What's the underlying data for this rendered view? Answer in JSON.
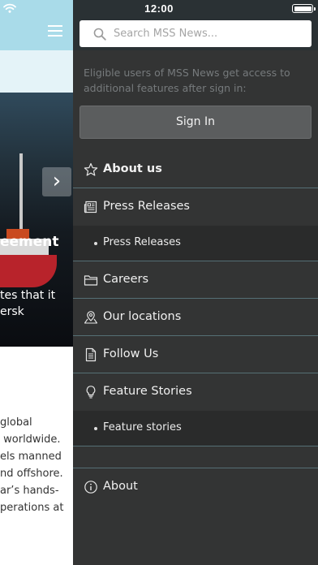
{
  "status_bar": {
    "time": "12:00"
  },
  "background_page": {
    "hero_title": "eement",
    "hero_body": "tes that it\nersk",
    "body_text": "global\n worldwide.\nels manned\nnd offshore.\nar’s hands-\nperations at"
  },
  "drawer": {
    "search": {
      "placeholder": "Search MSS News..."
    },
    "promo_text": "Eligible users of MSS News get access to additional features after sign in:",
    "sign_in_label": "Sign In",
    "items": [
      {
        "label": "About us",
        "icon": "star-icon"
      },
      {
        "label": "Press Releases",
        "icon": "newspaper-icon"
      },
      {
        "label": "Press Releases",
        "icon": "bullet"
      },
      {
        "label": "Careers",
        "icon": "folder-icon"
      },
      {
        "label": "Our locations",
        "icon": "map-pin-icon"
      },
      {
        "label": "Follow Us",
        "icon": "document-icon"
      },
      {
        "label": "Feature Stories",
        "icon": "lightbulb-icon"
      },
      {
        "label": "Feature stories",
        "icon": "bullet"
      },
      {
        "label": "About",
        "icon": "info-icon"
      }
    ]
  },
  "colors": {
    "drawer_bg": "#333434",
    "submenu_bg": "#2a2b2b",
    "divider": "#556f75",
    "header_bg": "#a9dbe9",
    "sign_in_bg": "#5b5d5e"
  }
}
